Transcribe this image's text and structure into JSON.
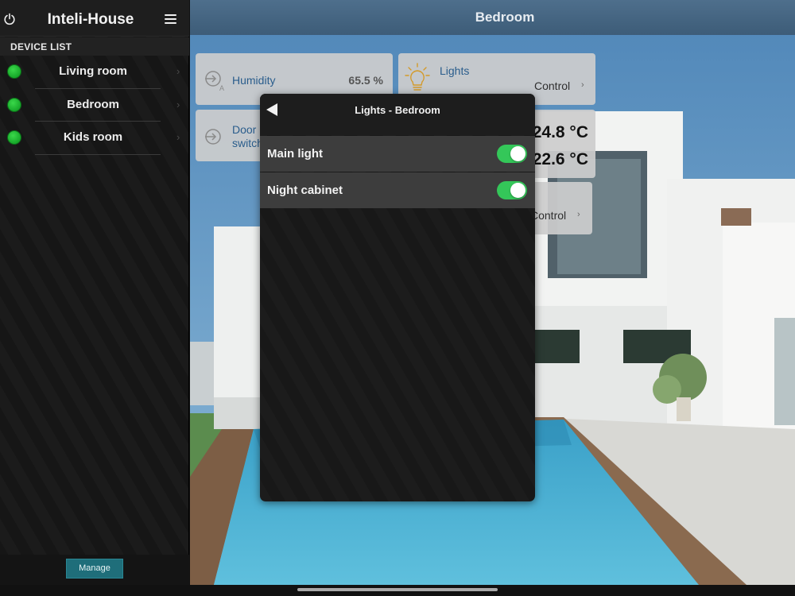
{
  "sidebar": {
    "title": "Inteli-House",
    "section_title": "DEVICE LIST",
    "devices": [
      {
        "label": "Living room",
        "status": "online"
      },
      {
        "label": "Bedroom",
        "status": "online"
      },
      {
        "label": "Kids room",
        "status": "online"
      }
    ],
    "chevron": "›",
    "manage_label": "Manage",
    "icons": {
      "power": "power-icon",
      "menu": "hamburger-menu-icon"
    }
  },
  "main": {
    "title": "Bedroom",
    "tiles": {
      "humidity": {
        "label": "Humidity",
        "value": "65.5 %",
        "icon": "sensor-auto-icon"
      },
      "lights": {
        "label": "Lights",
        "control": "Control",
        "chevron": "›",
        "icon": "light-bulb-icon"
      },
      "door": {
        "label_line1": "Door",
        "label_line2": "switch",
        "icon": "sensor-icon"
      },
      "temperature": {
        "value1": "24.8 °C",
        "value2": "22.6 °C"
      },
      "third_control": {
        "control": "Control",
        "chevron": "›"
      }
    }
  },
  "modal": {
    "title": "Lights - Bedroom",
    "items": [
      {
        "label": "Main light",
        "on": true
      },
      {
        "label": "Night cabinet",
        "on": true
      }
    ]
  },
  "colors": {
    "status_online": "#17a82a",
    "toggle_on": "#34c759",
    "accent_button": "#1f6e7a",
    "tile_label": "#2a5d8c"
  }
}
